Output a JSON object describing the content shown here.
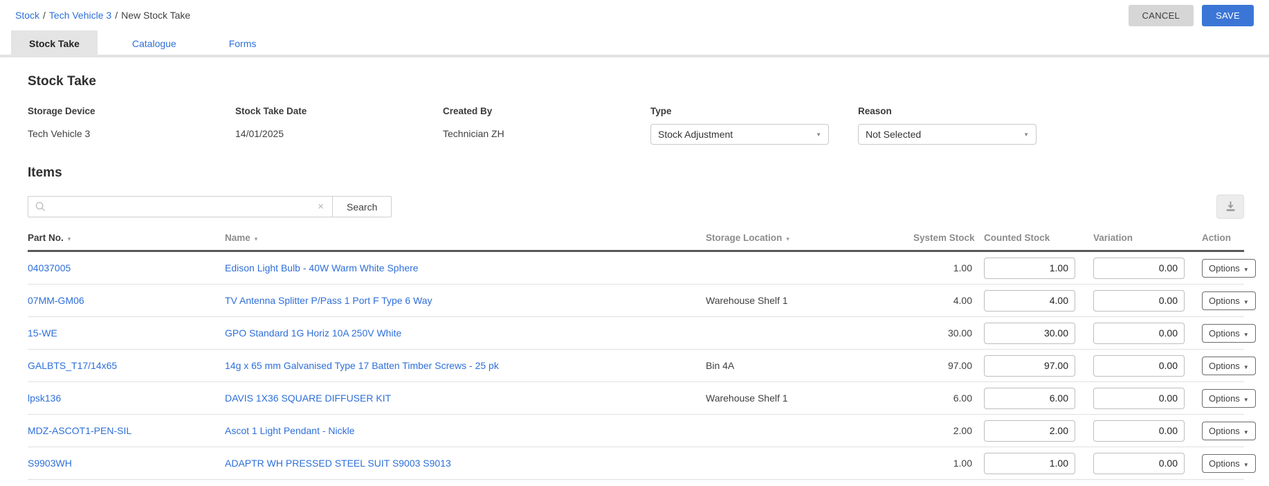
{
  "breadcrumb": {
    "separator": "/",
    "items": [
      {
        "label": "Stock"
      },
      {
        "label": "Tech Vehicle 3"
      },
      {
        "label": "New Stock Take"
      }
    ]
  },
  "actions": {
    "cancel_label": "CANCEL",
    "save_label": "SAVE"
  },
  "tabs": [
    {
      "label": "Stock Take",
      "active": true
    },
    {
      "label": "Catalogue",
      "active": false
    },
    {
      "label": "Forms",
      "active": false
    }
  ],
  "stock_take": {
    "title": "Stock Take",
    "fields": [
      {
        "label": "Storage Device",
        "value": "Tech Vehicle 3"
      },
      {
        "label": "Stock Take Date",
        "value": "14/01/2025"
      },
      {
        "label": "Created By",
        "value": "Technician ZH"
      },
      {
        "label": "Type",
        "value": "Stock Adjustment",
        "type": "select"
      },
      {
        "label": "Reason",
        "value": "Not Selected",
        "type": "select"
      }
    ]
  },
  "items": {
    "title": "Items",
    "search": {
      "value": "",
      "placeholder": "",
      "button_label": "Search"
    },
    "icons": {
      "search": "search-icon",
      "clear": "×",
      "sort_caret": "▾",
      "select_caret": "▼",
      "export": "download-icon"
    },
    "table": {
      "columns": [
        {
          "label": "Part No.",
          "sortable": true,
          "active": true
        },
        {
          "label": "Name",
          "sortable": true,
          "active": false
        },
        {
          "label": "Storage Location",
          "sortable": true,
          "active": false
        },
        {
          "label": "System Stock",
          "sortable": false
        },
        {
          "label": "Counted Stock",
          "sortable": false
        },
        {
          "label": "Variation",
          "sortable": false
        },
        {
          "label": "Action",
          "sortable": false
        }
      ],
      "options_label": "Options",
      "rows": [
        {
          "part_no": "04037005",
          "name": "Edison Light Bulb - 40W Warm White Sphere",
          "storage_location": "",
          "system_stock": "1.00",
          "counted_stock": "1.00",
          "variation": "0.00"
        },
        {
          "part_no": "07MM-GM06",
          "name": "TV Antenna Splitter P/Pass 1 Port F Type 6 Way",
          "storage_location": "Warehouse Shelf 1",
          "system_stock": "4.00",
          "counted_stock": "4.00",
          "variation": "0.00"
        },
        {
          "part_no": "15-WE",
          "name": "GPO Standard 1G Horiz 10A 250V White",
          "storage_location": "",
          "system_stock": "30.00",
          "counted_stock": "30.00",
          "variation": "0.00"
        },
        {
          "part_no": "GALBTS_T17/14x65",
          "name": "14g x 65 mm Galvanised Type 17 Batten Timber Screws - 25 pk",
          "storage_location": "Bin 4A",
          "system_stock": "97.00",
          "counted_stock": "97.00",
          "variation": "0.00"
        },
        {
          "part_no": "lpsk136",
          "name": "DAVIS 1X36 SQUARE DIFFUSER KIT",
          "storage_location": "Warehouse Shelf 1",
          "system_stock": "6.00",
          "counted_stock": "6.00",
          "variation": "0.00"
        },
        {
          "part_no": "MDZ-ASCOT1-PEN-SIL",
          "name": "Ascot 1 Light Pendant - Nickle",
          "storage_location": "",
          "system_stock": "2.00",
          "counted_stock": "2.00",
          "variation": "0.00"
        },
        {
          "part_no": "S9903WH",
          "name": "ADAPTR WH PRESSED STEEL SUIT S9003 S9013",
          "storage_location": "",
          "system_stock": "1.00",
          "counted_stock": "1.00",
          "variation": "0.00"
        }
      ]
    }
  },
  "colors": {
    "link": "#2e6fd9",
    "save_button": "#3b76d7",
    "cancel_button": "#d6d6d6",
    "active_tab_bg": "#e4e4e4",
    "header_text": "#8c8c8c",
    "header_border": "#595959",
    "row_border": "#e0e0e0"
  }
}
